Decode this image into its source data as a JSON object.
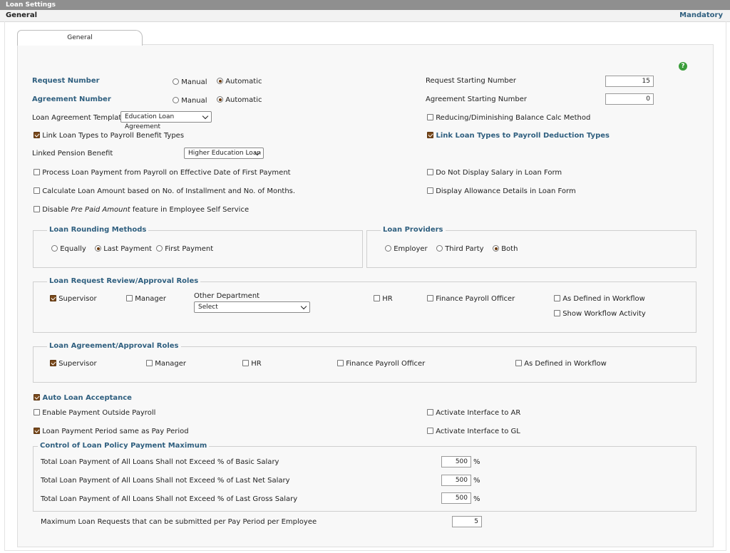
{
  "header": {
    "title": "Loan Settings",
    "section": "General",
    "mandatory": "Mandatory"
  },
  "tab": {
    "label": "General"
  },
  "help_icon": "?",
  "request_number": {
    "label": "Request Number",
    "manual": "Manual",
    "automatic": "Automatic",
    "selected": "Automatic"
  },
  "agreement_number": {
    "label": "Agreement Number",
    "manual": "Manual",
    "automatic": "Automatic",
    "selected": "Automatic"
  },
  "request_starting": {
    "label": "Request Starting Number",
    "value": "15"
  },
  "agreement_starting": {
    "label": "Agreement Starting Number",
    "value": "0"
  },
  "loan_template": {
    "label": "Loan Agreement Template",
    "value": "Education Loan Agreement"
  },
  "reducing_balance": {
    "label": "Reducing/Diminishing Balance Calc Method",
    "checked": false
  },
  "link_benefit": {
    "label": "Link Loan Types to Payroll Benefit Types",
    "checked": true
  },
  "link_deduction": {
    "label": "Link Loan Types to Payroll Deduction Types",
    "checked": true
  },
  "pension": {
    "label": "Linked Pension Benefit",
    "value": "Higher Education Loan"
  },
  "process_payment": {
    "label": "Process Loan Payment from Payroll on Effective Date of First Payment",
    "checked": false
  },
  "no_salary": {
    "label": "Do Not Display Salary in Loan Form",
    "checked": false
  },
  "calc_amount": {
    "label": "Calculate Loan Amount based on No. of Installment and No. of Months.",
    "checked": false
  },
  "allowance": {
    "label": "Display Allowance Details in Loan Form",
    "checked": false
  },
  "disable_prepaid": {
    "pre": "Disable ",
    "em": "Pre Paid Amount",
    "post": " feature in Employee Self Service",
    "checked": false
  },
  "rounding": {
    "title": "Loan Rounding Methods",
    "equally": "Equally",
    "last": "Last Payment",
    "first": "First Payment",
    "selected": "Last Payment"
  },
  "providers": {
    "title": "Loan Providers",
    "employer": "Employer",
    "third": "Third Party",
    "both": "Both",
    "selected": "Both"
  },
  "request_roles": {
    "title": "Loan Request Review/Approval Roles",
    "supervisor": "Supervisor",
    "manager": "Manager",
    "other_dept": "Other Department",
    "select": "Select",
    "hr": "HR",
    "finance": "Finance Payroll Officer",
    "workflow": "As Defined in Workflow",
    "show_workflow": "Show Workflow Activity"
  },
  "agreement_roles": {
    "title": "Loan Agreement/Approval Roles",
    "supervisor": "Supervisor",
    "manager": "Manager",
    "hr": "HR",
    "finance": "Finance Payroll Officer",
    "workflow": "As Defined in Workflow"
  },
  "auto_accept": {
    "label": "Auto Loan Acceptance",
    "checked": true
  },
  "outside_payroll": {
    "label": "Enable Payment Outside Payroll",
    "checked": false
  },
  "interface_ar": {
    "label": "Activate Interface to AR",
    "checked": false
  },
  "pay_period": {
    "label": "Loan Payment Period same as Pay Period",
    "checked": true
  },
  "interface_gl": {
    "label": "Activate Interface to GL",
    "checked": false
  },
  "control": {
    "title": "Control of Loan Policy Payment Maximum",
    "rows": [
      {
        "label": "Total Loan Payment of All Loans Shall not Exceed % of Basic Salary",
        "value": "500",
        "unit": "%"
      },
      {
        "label": "Total Loan Payment of All Loans Shall not Exceed % of Last Net Salary",
        "value": "500",
        "unit": "%"
      },
      {
        "label": "Total Loan Payment of All Loans Shall not Exceed % of Last Gross Salary",
        "value": "500",
        "unit": "%"
      }
    ]
  },
  "max_requests": {
    "label": "Maximum Loan Requests that can be submitted per Pay Period per Employee",
    "value": "5"
  }
}
